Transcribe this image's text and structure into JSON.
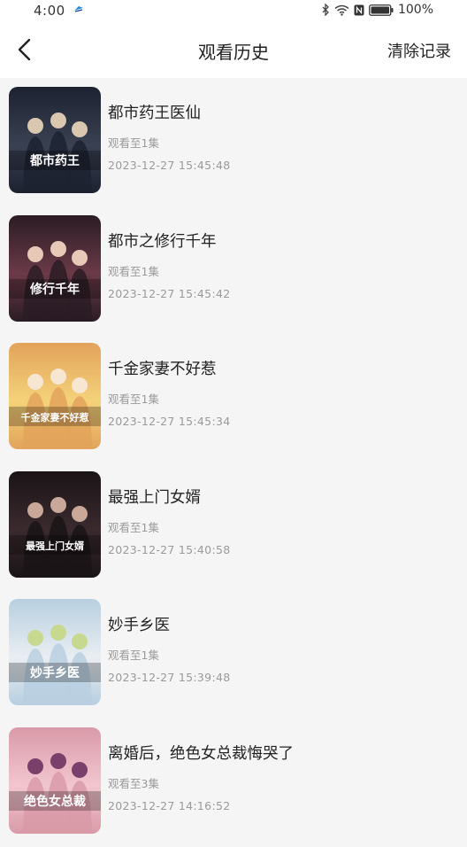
{
  "status_bar": {
    "time": "4:00",
    "battery": "100%",
    "icons": [
      "app-notification-icon",
      "bluetooth-icon",
      "wifi-icon",
      "nfc-icon",
      "battery-icon"
    ]
  },
  "header": {
    "title": "观看历史",
    "clear_label": "清除记录",
    "back_icon": "chevron-left-icon"
  },
  "history": [
    {
      "title": "都市药王医仙",
      "episode": "观看至1集",
      "time": "2023-12-27 15:45:48",
      "poster_text": "都市药王",
      "poster_colors": [
        "#1c2230",
        "#3a4152",
        "#d9c7b0"
      ]
    },
    {
      "title": "都市之修行千年",
      "episode": "观看至1集",
      "time": "2023-12-27 15:45:42",
      "poster_text": "修行千年",
      "poster_colors": [
        "#2a1c24",
        "#6b3a48",
        "#e8c9b8"
      ]
    },
    {
      "title": "千金家妻不好惹",
      "episode": "观看至1集",
      "time": "2023-12-27 15:45:34",
      "poster_text": "千金家妻不好惹",
      "poster_colors": [
        "#e2a35a",
        "#f4d27a",
        "#f6e6d2"
      ]
    },
    {
      "title": "最强上门女婿",
      "episode": "观看至1集",
      "time": "2023-12-27 15:40:58",
      "poster_text": "最强上门女婿",
      "poster_colors": [
        "#1a1416",
        "#3a2a2e",
        "#c9a89a"
      ]
    },
    {
      "title": "妙手乡医",
      "episode": "观看至1集",
      "time": "2023-12-27 15:39:48",
      "poster_text": "妙手乡医",
      "poster_colors": [
        "#b8cfe0",
        "#e9eef2",
        "#c7d88f"
      ]
    },
    {
      "title": "离婚后，绝色女总裁悔哭了",
      "episode": "观看至3集",
      "time": "2023-12-27 14:16:52",
      "poster_text": "绝色女总裁",
      "poster_colors": [
        "#d99aa8",
        "#f2c6cf",
        "#7a3f6a"
      ]
    }
  ]
}
